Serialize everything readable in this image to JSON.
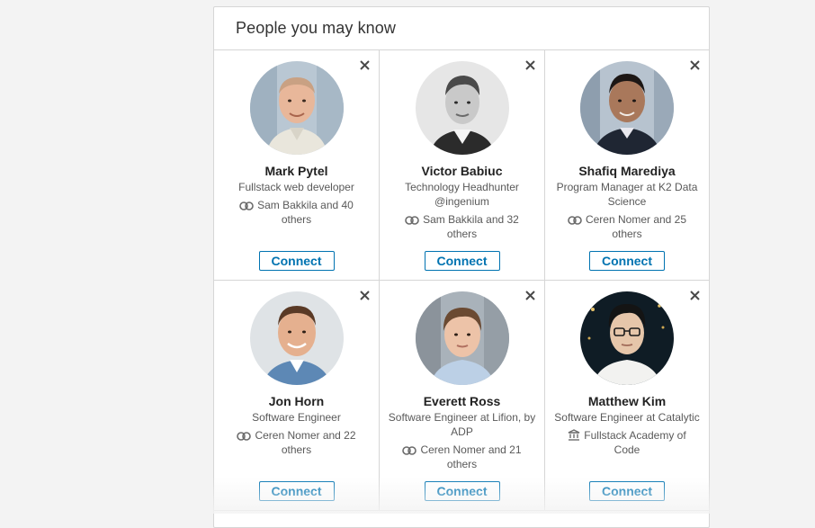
{
  "panel": {
    "title": "People you may know"
  },
  "people": [
    {
      "name": "Mark Pytel",
      "headline": "Fullstack web developer",
      "mutual": "Sam Bakkila and 40 others",
      "mutual_icon": "connections-icon",
      "connect_label": "Connect",
      "dismiss_label": "×"
    },
    {
      "name": "Victor Babiuc",
      "headline": "Technology Headhunter @ingenium",
      "mutual": "Sam Bakkila and 32 others",
      "mutual_icon": "connections-icon",
      "connect_label": "Connect",
      "dismiss_label": "×"
    },
    {
      "name": "Shafiq Marediya",
      "headline": "Program Manager at K2 Data Science",
      "mutual": "Ceren Nomer and 25 others",
      "mutual_icon": "connections-icon",
      "connect_label": "Connect",
      "dismiss_label": "×"
    },
    {
      "name": "Jon Horn",
      "headline": "Software Engineer",
      "mutual": "Ceren Nomer and 22 others",
      "mutual_icon": "connections-icon",
      "connect_label": "Connect",
      "dismiss_label": "×"
    },
    {
      "name": "Everett Ross",
      "headline": "Software Engineer at Lifion, by ADP",
      "mutual": "Ceren Nomer and 21 others",
      "mutual_icon": "connections-icon",
      "connect_label": "Connect",
      "dismiss_label": "×"
    },
    {
      "name": "Matthew Kim",
      "headline": "Software Engineer at Catalytic",
      "mutual": "Fullstack Academy of Code",
      "mutual_icon": "school-icon",
      "connect_label": "Connect",
      "dismiss_label": "×"
    }
  ],
  "colors": {
    "accent": "#0073b1",
    "border": "#d6d6d6",
    "background": "#f3f3f3"
  }
}
